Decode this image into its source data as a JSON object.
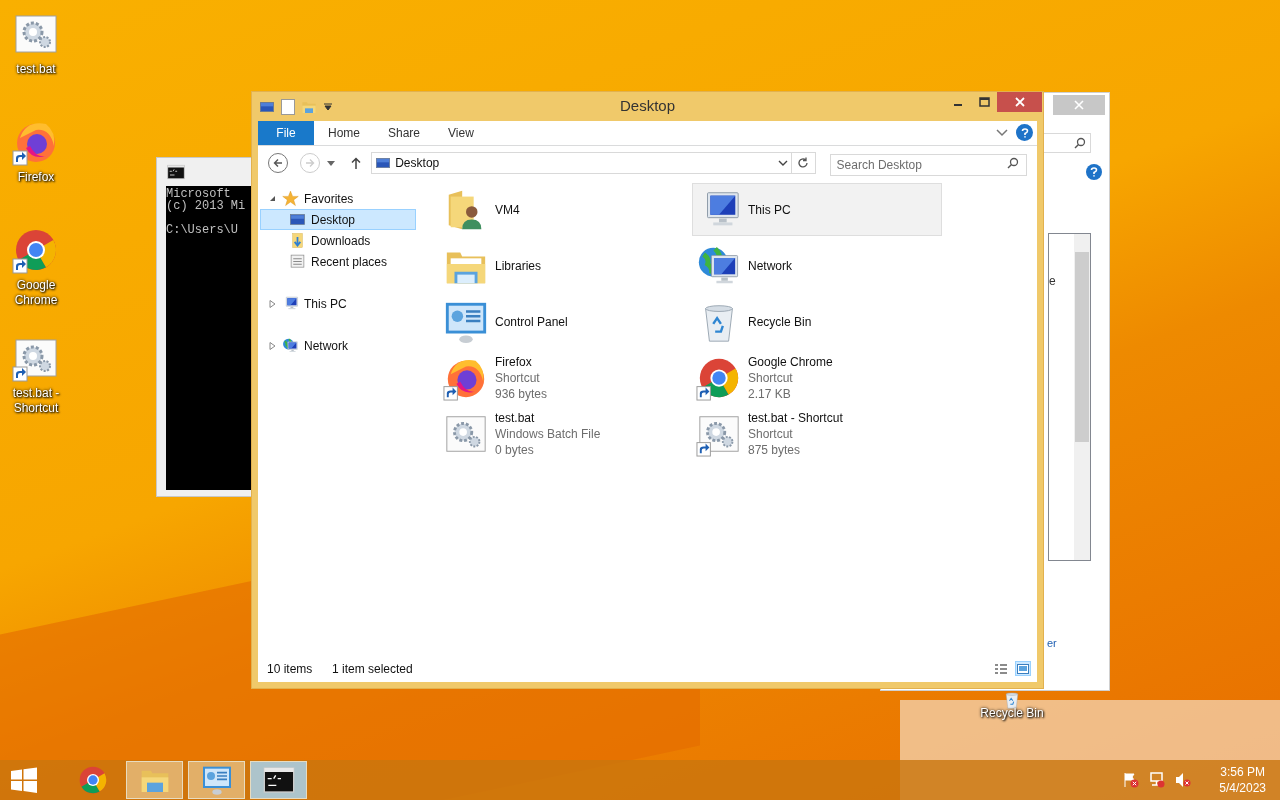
{
  "desktop_icons": [
    {
      "label": "test.bat",
      "kind": "bat"
    },
    {
      "label": "Firefox",
      "kind": "firefox"
    },
    {
      "label": "Google Chrome",
      "kind": "chrome"
    },
    {
      "label": "test.bat - Shortcut",
      "kind": "bat_shortcut"
    }
  ],
  "corner_icon": {
    "label": "Recycle Bin",
    "kind": "recycle"
  },
  "cmd_window": {
    "lines": [
      {
        "text": "Microsoft"
      },
      {
        "text": "(c) 2013 Mi"
      },
      {
        "text": "C:\\Users\\U",
        "gap_before": true
      }
    ]
  },
  "back_window": {
    "fragments": [
      "e",
      "er"
    ]
  },
  "explorer": {
    "title": "Desktop",
    "ribbon_tabs": [
      {
        "label": "File",
        "kind": "file"
      },
      {
        "label": "Home",
        "kind": "tab"
      },
      {
        "label": "Share",
        "kind": "tab"
      },
      {
        "label": "View",
        "kind": "tab"
      }
    ],
    "address": "Desktop",
    "search": {
      "placeholder": "Search Desktop"
    },
    "nav_tree": [
      {
        "label": "Favorites",
        "kind": "star",
        "expanded": true,
        "selected": false,
        "children": [
          {
            "label": "Desktop",
            "kind": "desktop",
            "selected": true
          },
          {
            "label": "Downloads",
            "kind": "downloads",
            "selected": false
          },
          {
            "label": "Recent places",
            "kind": "recent",
            "selected": false
          }
        ]
      },
      {
        "label": "This PC",
        "kind": "pc",
        "expanded": false,
        "selected": false
      },
      {
        "label": "Network",
        "kind": "network",
        "expanded": false,
        "selected": false
      }
    ],
    "items": [
      {
        "name": "VM4",
        "kind": "user_folder",
        "selected": false
      },
      {
        "name": "This PC",
        "kind": "pc",
        "selected": true
      },
      {
        "name": "Libraries",
        "kind": "libraries",
        "selected": false
      },
      {
        "name": "Network",
        "kind": "network",
        "selected": false
      },
      {
        "name": "Control Panel",
        "kind": "control_panel",
        "selected": false
      },
      {
        "name": "Recycle Bin",
        "kind": "recycle",
        "selected": false
      },
      {
        "name": "Firefox",
        "details": [
          "Shortcut",
          "936 bytes"
        ],
        "kind": "firefox",
        "selected": false
      },
      {
        "name": "Google Chrome",
        "details": [
          "Shortcut",
          "2.17 KB"
        ],
        "kind": "chrome",
        "selected": false
      },
      {
        "name": "test.bat",
        "details": [
          "Windows Batch File",
          "0 bytes"
        ],
        "kind": "bat",
        "selected": false
      },
      {
        "name": "test.bat - Shortcut",
        "details": [
          "Shortcut",
          "875 bytes"
        ],
        "kind": "bat_shortcut",
        "selected": false
      }
    ],
    "status": {
      "count": "10 items",
      "selection": "1 item selected"
    },
    "views": [
      {
        "kind": "details",
        "selected": false
      },
      {
        "kind": "large",
        "selected": true
      }
    ]
  },
  "taskbar": {
    "buttons": [
      {
        "kind": "chrome",
        "active": false,
        "running": false
      },
      {
        "kind": "explorer",
        "active": false,
        "running": true
      },
      {
        "kind": "control_panel",
        "active": false,
        "running": true
      },
      {
        "kind": "cmd",
        "active": true,
        "running": true
      }
    ],
    "time": "3:56 PM",
    "date": "5/4/2023"
  }
}
